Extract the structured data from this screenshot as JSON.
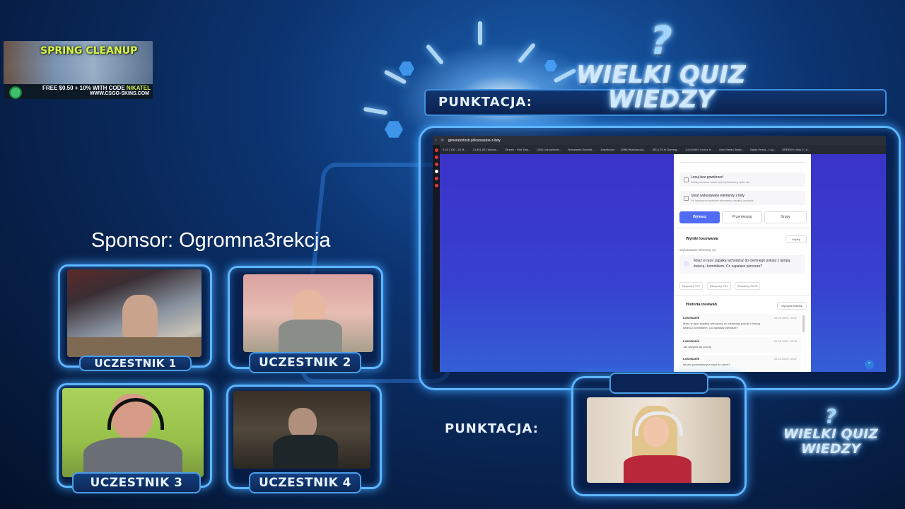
{
  "sponsor_banner": {
    "title": "SPRING CLEANUP",
    "promo": "FREE $0.50 + 10% WITH CODE",
    "code": "NIKATEL",
    "url": "WWW.CSGO-SKINS.COM"
  },
  "sponsor_text": "Sponsor: Ogromna3rekcja",
  "scores": {
    "top_label": "PUNKTACJA:",
    "bottom_label": "PUNKTACJA:"
  },
  "logo": {
    "line1": "WIELKI QUIZ",
    "line2": "WIEDZY"
  },
  "participants": [
    {
      "label": "UCZESTNIK 1"
    },
    {
      "label": "UCZESTNIK 2"
    },
    {
      "label": "UCZESTNIK 3"
    },
    {
      "label": "UCZESTNIK 4"
    }
  ],
  "browser": {
    "url": "generatorlosb.pl/losowanie-z-listy",
    "bookmarks": [
      "0.16 | 100 - 30 M...",
      "13,891,821 Wartos...",
      "Stream - Kick Das...",
      "(303) Jak wykonic...",
      "Notowania Giereldi...",
      "Dashboard",
      "(598) Wiadomosci...",
      "(95) | 25-tk Gaming...",
      "(14) KMKS l mecz fr...",
      "Kick Stefan Syste...",
      "Nasty Snack - Log...",
      "GREEDS: Wrip 2 | d..."
    ],
    "options": [
      {
        "title": "Losuj bez powtórzeń",
        "desc": "Każdy element może być wylosowany tylko raz"
      },
      {
        "title": "Usuń wylosowane elementy z listy",
        "desc": "Po losowaniu wybrane elementy zostaną usunięte"
      }
    ],
    "buttons": {
      "draw": "Wylosuj",
      "shuffle": "Przemieszaj",
      "groups": "Grupy"
    },
    "results_title": "Wyniki losowania",
    "copy_label": "Kopiuj",
    "results_sub": "Wylosowane elementy (1)",
    "result_text": "Masz w ręce zapałkę wchodzisz do ciemnego pokoju z lampą świecą i kominkiem. Co zapalasz pierwsze?",
    "export": [
      "Eksportuj TXT",
      "Eksportuj CSV",
      "Eksportuj JSON"
    ],
    "history_title": "Historia losowań",
    "clear_label": "Wyczyść historię",
    "history": [
      {
        "label": "Losowanie",
        "date": "20.03.2025, 18:31",
        "text": "Masz w ręce zapałkę wchodzisz do ciemnego pokoju z lampą świecą i kominkiem. Co zapalasz pierwsze?"
      },
      {
        "label": "Losowanie",
        "date": "20.03.2025, 18:30",
        "text": "Jak nazywa się pocztę"
      },
      {
        "label": "Losowanie",
        "date": "20.03.2025, 18:27",
        "text": "Ile jest powiedzianych słów w rolach?"
      }
    ]
  },
  "colors": {
    "accent": "#5fb6ff",
    "background": "#0c3471",
    "app_purple": "#3b33c9",
    "button_blue": "#4f6cf2"
  }
}
